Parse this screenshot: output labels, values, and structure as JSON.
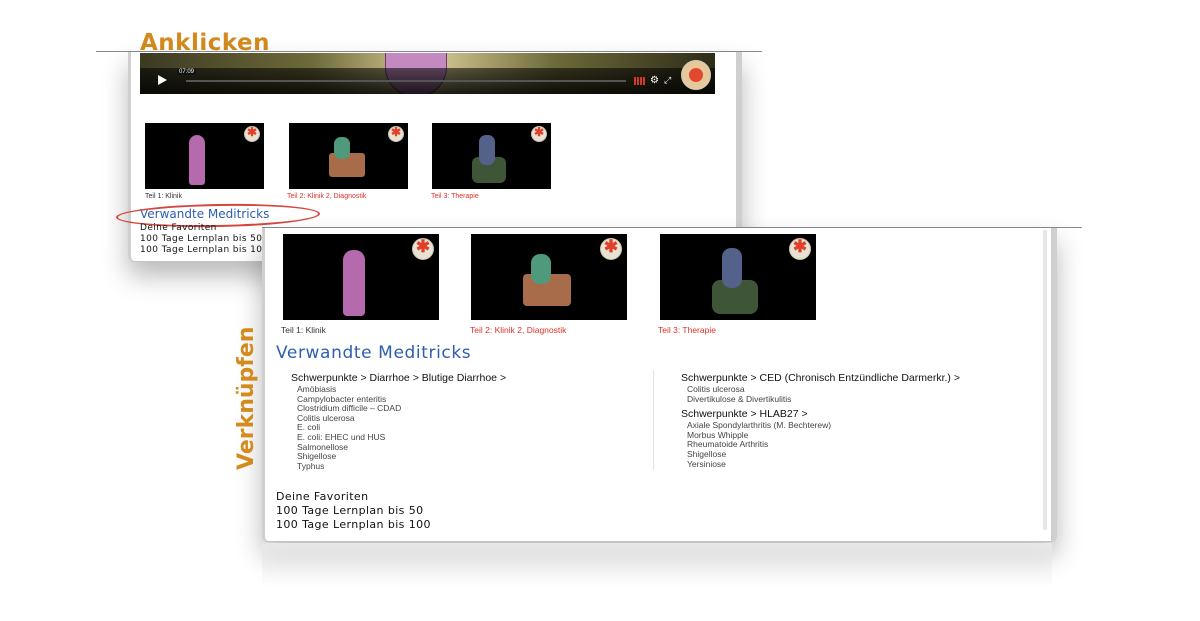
{
  "annotations": {
    "click": "Anklicken",
    "link": "Verknüpfen"
  },
  "video": {
    "time": "07:09"
  },
  "thumbnails": [
    {
      "caption": "Teil 1: Klinik",
      "state": "current"
    },
    {
      "caption": "Teil 2: Klinik 2, Diagnostik",
      "state": "link"
    },
    {
      "caption": "Teil 3: Therapie",
      "state": "link"
    }
  ],
  "related": {
    "title": "Verwandte Meditricks",
    "groups_left": [
      {
        "heading": "Schwerpunkte > Diarrhoe > Blutige Diarrhoe >",
        "items": [
          "Amöbiasis",
          "Campylobacter enteritis",
          "Clostridium difficile – CDAD",
          "Colitis ulcerosa",
          "E. coli",
          "E. coli: EHEC und HUS",
          "Salmonellose",
          "Shigellose",
          "Typhus"
        ]
      }
    ],
    "groups_right": [
      {
        "heading": "Schwerpunkte > CED (Chronisch Entzündliche Darmerkr.) >",
        "items": [
          "Colitis ulcerosa",
          "Divertikulose & Divertikulitis"
        ]
      },
      {
        "heading": "Schwerpunkte > HLAB27 >",
        "items": [
          "Axiale Spondylarthritis (M. Bechterew)",
          "Morbus Whipple",
          "Rheumatoide Arthritis",
          "Shigellose",
          "Yersiniose"
        ]
      }
    ]
  },
  "plans": [
    "Deine Favoriten",
    "100 Tage Lernplan bis 50",
    "100 Tage Lernplan bis 100"
  ],
  "colors": {
    "annotation": "#d48a1c",
    "link_red": "#e0312a",
    "related_blue": "#2d5fb0",
    "highlight_oval": "#d6463f"
  }
}
